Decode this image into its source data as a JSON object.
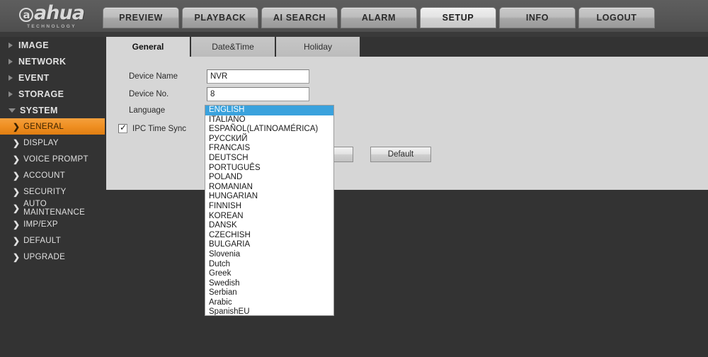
{
  "brand": {
    "name": "ahua",
    "at_glyph": "a",
    "tagline": "TECHNOLOGY"
  },
  "header": {
    "tabs": [
      {
        "label": "PREVIEW",
        "active": false
      },
      {
        "label": "PLAYBACK",
        "active": false
      },
      {
        "label": "AI SEARCH",
        "active": false
      },
      {
        "label": "ALARM",
        "active": false
      },
      {
        "label": "SETUP",
        "active": true
      },
      {
        "label": "INFO",
        "active": false
      },
      {
        "label": "LOGOUT",
        "active": false
      }
    ]
  },
  "sidebar": {
    "groups": [
      {
        "label": "IMAGE",
        "expanded": false,
        "icon": "triangle-right-icon"
      },
      {
        "label": "NETWORK",
        "expanded": false,
        "icon": "triangle-right-icon"
      },
      {
        "label": "EVENT",
        "expanded": false,
        "icon": "triangle-right-icon"
      },
      {
        "label": "STORAGE",
        "expanded": false,
        "icon": "triangle-right-icon"
      },
      {
        "label": "SYSTEM",
        "expanded": true,
        "icon": "triangle-down-icon"
      }
    ],
    "system_items": [
      {
        "label": "GENERAL",
        "active": true,
        "icon": "chevron-right-icon"
      },
      {
        "label": "DISPLAY",
        "active": false,
        "icon": "chevron-right-icon"
      },
      {
        "label": "VOICE PROMPT",
        "active": false,
        "icon": "chevron-right-icon"
      },
      {
        "label": "ACCOUNT",
        "active": false,
        "icon": "chevron-right-icon"
      },
      {
        "label": "SECURITY",
        "active": false,
        "icon": "chevron-right-icon"
      },
      {
        "label": "AUTO MAINTENANCE",
        "active": false,
        "icon": "chevron-right-icon"
      },
      {
        "label": "IMP/EXP",
        "active": false,
        "icon": "chevron-right-icon"
      },
      {
        "label": "DEFAULT",
        "active": false,
        "icon": "chevron-right-icon"
      },
      {
        "label": "UPGRADE",
        "active": false,
        "icon": "chevron-right-icon"
      }
    ],
    "chevron_glyph": "❯",
    "highlight_color": "#ef8f22"
  },
  "content": {
    "tabs": [
      {
        "label": "General",
        "active": true
      },
      {
        "label": "Date&Time",
        "active": false
      },
      {
        "label": "Holiday",
        "active": false
      }
    ],
    "form": {
      "device_name_label": "Device Name",
      "device_name_value": "NVR",
      "device_no_label": "Device No.",
      "device_no_value": "8",
      "language_label": "Language",
      "ipc_time_sync_label": "IPC Time Sync",
      "ipc_time_sync_checked": true
    },
    "buttons": {
      "save_label": "",
      "default_label": "Default"
    }
  },
  "language_dropdown": {
    "selected": "ENGLISH",
    "highlight_color": "#3aa2dd",
    "options": [
      "ENGLISH",
      "ITALIANO",
      "ESPAÑOL(LATINOAMÉRICA)",
      "РУССКИЙ",
      "FRANCAIS",
      "DEUTSCH",
      "PORTUGUÊS",
      "POLAND",
      "ROMANIAN",
      "HUNGARIAN",
      "FINNISH",
      "KOREAN",
      "DANSK",
      "CZECHISH",
      "BULGARIA",
      "Slovenia",
      "Dutch",
      "Greek",
      "Swedish",
      "Serbian",
      "Arabic",
      "SpanishEU"
    ]
  }
}
